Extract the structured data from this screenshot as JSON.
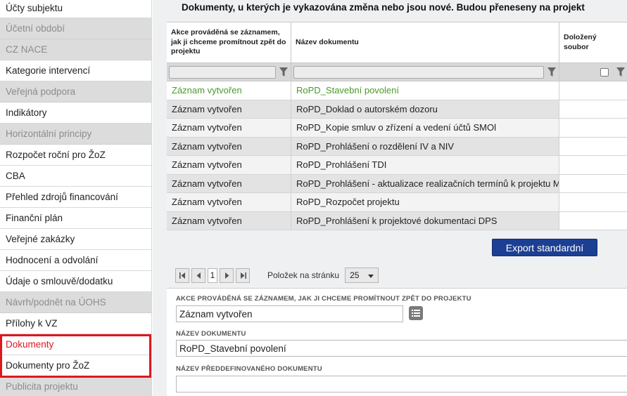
{
  "sidebar": {
    "items": [
      {
        "label": "Účty subjektu",
        "state": "normal"
      },
      {
        "label": "Účetní období",
        "state": "disabled"
      },
      {
        "label": "CZ NACE",
        "state": "disabled"
      },
      {
        "label": "Kategorie intervencí",
        "state": "normal"
      },
      {
        "label": "Veřejná podpora",
        "state": "disabled"
      },
      {
        "label": "Indikátory",
        "state": "normal"
      },
      {
        "label": "Horizontální principy",
        "state": "disabled"
      },
      {
        "label": "Rozpočet roční pro ŽoZ",
        "state": "normal"
      },
      {
        "label": "CBA",
        "state": "normal"
      },
      {
        "label": "Přehled zdrojů financování",
        "state": "normal"
      },
      {
        "label": "Finanční plán",
        "state": "normal"
      },
      {
        "label": "Veřejné zakázky",
        "state": "normal"
      },
      {
        "label": "Hodnocení a odvolání",
        "state": "normal"
      },
      {
        "label": "Údaje o smlouvě/dodatku",
        "state": "normal"
      },
      {
        "label": "Návrh/podnět na ÚOHS",
        "state": "disabled"
      },
      {
        "label": "Přílohy k VZ",
        "state": "normal"
      },
      {
        "label": "Dokumenty",
        "state": "active"
      },
      {
        "label": "Dokumenty pro ŽoZ",
        "state": "normal"
      },
      {
        "label": "Publicita projektu",
        "state": "disabled"
      }
    ]
  },
  "main": {
    "title": "Dokumenty, u kterých je vykazována změna nebo jsou nové. Budou přeneseny na projekt",
    "columns": [
      "Akce prováděná se záznamem, jak ji chceme promítnout zpět do projektu",
      "Název dokumentu",
      "Doložený soubor"
    ],
    "rows": [
      {
        "action": "Záznam vytvořen",
        "name": "RoPD_Stavební povolení"
      },
      {
        "action": "Záznam vytvořen",
        "name": "RoPD_Doklad o autorském dozoru"
      },
      {
        "action": "Záznam vytvořen",
        "name": "RoPD_Kopie smluv o zřízení a vedení účtů SMOl"
      },
      {
        "action": "Záznam vytvořen",
        "name": "RoPD_Prohlášení o rozdělení IV a NIV"
      },
      {
        "action": "Záznam vytvořen",
        "name": "RoPD_Prohlášení TDI"
      },
      {
        "action": "Záznam vytvořen",
        "name": "RoPD_Prohlášení - aktualizace realizačních termínů k projektu M..."
      },
      {
        "action": "Záznam vytvořen",
        "name": "RoPD_Rozpočet projektu"
      },
      {
        "action": "Záznam vytvořen",
        "name": "RoPD_Prohlášení k projektové dokumentaci DPS"
      }
    ],
    "export_label": "Export standardní",
    "pager": {
      "current_page": "1",
      "per_page_label": "Položek na stránku",
      "per_page_value": "25"
    },
    "detail": {
      "action_label": "AKCE PROVÁDĚNÁ SE ZÁZNAMEM, JAK JI CHCEME PROMÍTNOUT ZPĚT DO PROJEKTU",
      "action_value": "Záznam vytvořen",
      "name_label": "NÁZEV DOKUMENTU",
      "name_value": "RoPD_Stavební povolení",
      "predef_label": "NÁZEV PŘEDDEFINOVANÉHO DOKUMENTU",
      "predef_value": ""
    }
  },
  "colors": {
    "accent": "#1c3f93",
    "highlight": "#e0161f",
    "selected_text": "#4a9a2a"
  }
}
